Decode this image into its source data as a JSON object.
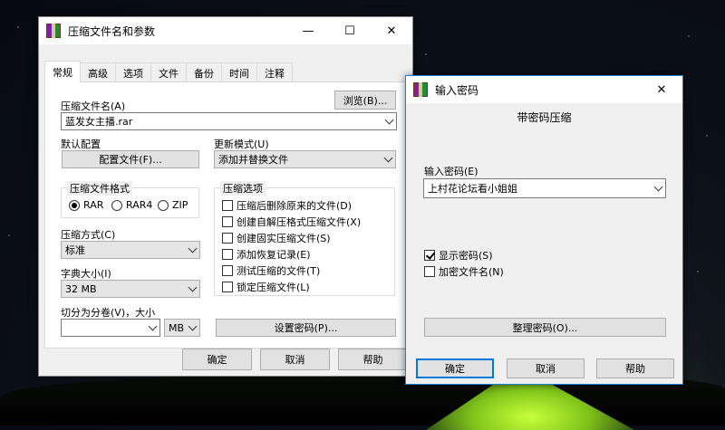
{
  "main_window": {
    "title": "压缩文件名和参数",
    "controls": {
      "minimize": "—",
      "maximize": "☐",
      "close": "✕"
    },
    "tabs": [
      "常规",
      "高级",
      "选项",
      "文件",
      "备份",
      "时间",
      "注释"
    ],
    "active_tab": "常规",
    "archive_name_label": "压缩文件名(A)",
    "browse_button": "浏览(B)...",
    "archive_name_value": "蓝发女主播.rar",
    "default_profile_label": "默认配置",
    "profile_button": "配置文件(F)...",
    "update_mode_label": "更新模式(U)",
    "update_mode_value": "添加并替换文件",
    "format_group_title": "压缩文件格式",
    "formats": [
      {
        "label": "RAR",
        "selected": true
      },
      {
        "label": "RAR4",
        "selected": false
      },
      {
        "label": "ZIP",
        "selected": false
      }
    ],
    "method_label": "压缩方式(C)",
    "method_value": "标准",
    "dict_label": "字典大小(I)",
    "dict_value": "32 MB",
    "split_label": "切分为分卷(V)，大小",
    "split_value": "",
    "split_unit": "MB",
    "options_group_title": "压缩选项",
    "options": [
      {
        "label": "压缩后删除原来的文件(D)",
        "checked": false
      },
      {
        "label": "创建自解压格式压缩文件(X)",
        "checked": false
      },
      {
        "label": "创建固实压缩文件(S)",
        "checked": false
      },
      {
        "label": "添加恢复记录(E)",
        "checked": false
      },
      {
        "label": "测试压缩的文件(T)",
        "checked": false
      },
      {
        "label": "锁定压缩文件(L)",
        "checked": false
      }
    ],
    "set_password_button": "设置密码(P)...",
    "ok_button": "确定",
    "cancel_button": "取消",
    "help_button": "帮助"
  },
  "password_dialog": {
    "title": "输入密码",
    "close": "✕",
    "heading": "带密码压缩",
    "password_label": "输入密码(E)",
    "password_value": "上村花论坛看小姐姐",
    "show_password_label": "显示密码(S)",
    "show_password_checked": true,
    "encrypt_names_label": "加密文件名(N)",
    "encrypt_names_checked": false,
    "organize_button": "整理密码(O)...",
    "ok_button": "确定",
    "cancel_button": "取消",
    "help_button": "帮助"
  }
}
